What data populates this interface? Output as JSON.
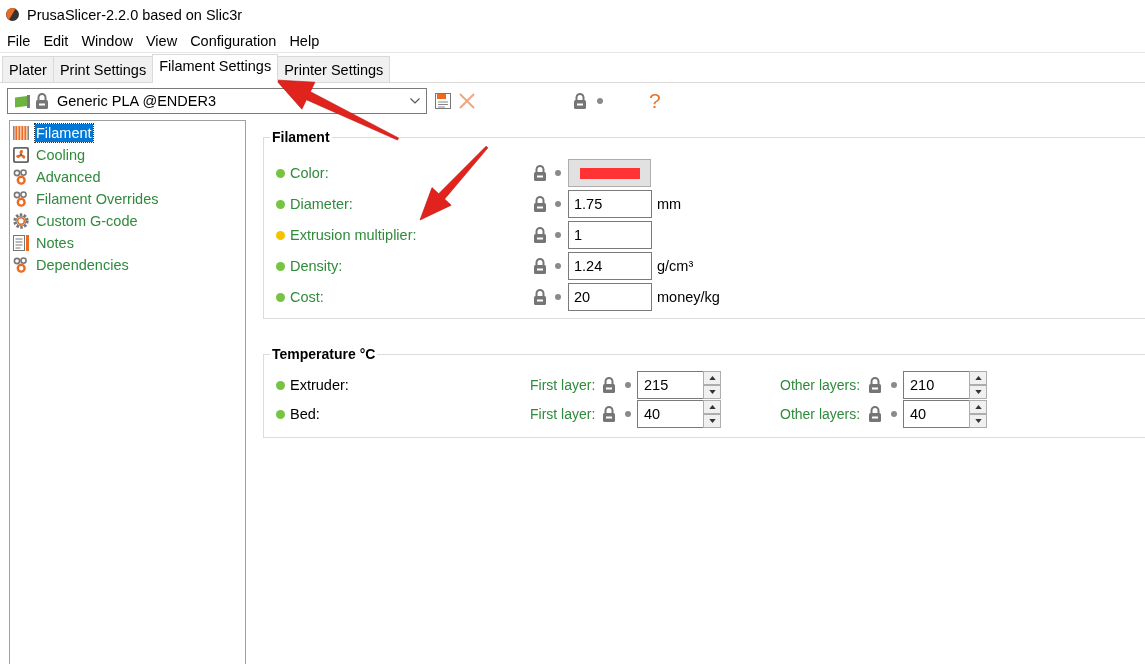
{
  "window": {
    "title": "PrusaSlicer-2.2.0 based on Slic3r"
  },
  "menu": [
    "File",
    "Edit",
    "Window",
    "View",
    "Configuration",
    "Help"
  ],
  "tabs": [
    {
      "label": "Plater",
      "selected": false
    },
    {
      "label": "Print Settings",
      "selected": false
    },
    {
      "label": "Filament Settings",
      "selected": true
    },
    {
      "label": "Printer Settings",
      "selected": false
    }
  ],
  "preset": {
    "name": "Generic PLA @ENDER3"
  },
  "toolbar": {
    "help": "?"
  },
  "sidebar": {
    "items": [
      {
        "label": "Filament",
        "selected": true
      },
      {
        "label": "Cooling",
        "selected": false
      },
      {
        "label": "Advanced",
        "selected": false
      },
      {
        "label": "Filament Overrides",
        "selected": false
      },
      {
        "label": "Custom G-code",
        "selected": false
      },
      {
        "label": "Notes",
        "selected": false
      },
      {
        "label": "Dependencies",
        "selected": false
      }
    ]
  },
  "filament_group": {
    "title": "Filament",
    "options": [
      {
        "kind": "color",
        "label": "Color:",
        "color": "#76c442",
        "swatch": {
          "color": "#ff3333"
        }
      },
      {
        "kind": "number",
        "label": "Diameter:",
        "color": "#76c442",
        "value": "1.75",
        "unit": "mm"
      },
      {
        "kind": "number",
        "label": "Extrusion multiplier:",
        "color": "#f5c400",
        "value": "1"
      },
      {
        "kind": "number",
        "label": "Density:",
        "color": "#76c442",
        "value": "1.24",
        "unit": "g/cm³"
      },
      {
        "kind": "number",
        "label": "Cost:",
        "color": "#76c442",
        "value": "20",
        "unit": "money/kg"
      }
    ]
  },
  "temperature_group": {
    "title": "Temperature °C",
    "rows": [
      {
        "label": "Extruder:",
        "color": "#76c442",
        "fields": [
          {
            "label": "First layer:",
            "value": "215"
          },
          {
            "label": "Other layers:",
            "value": "210"
          }
        ]
      },
      {
        "label": "Bed:",
        "color": "#76c442",
        "fields": [
          {
            "label": "First layer:",
            "value": "40"
          },
          {
            "label": "Other layers:",
            "value": "40"
          }
        ]
      }
    ]
  }
}
